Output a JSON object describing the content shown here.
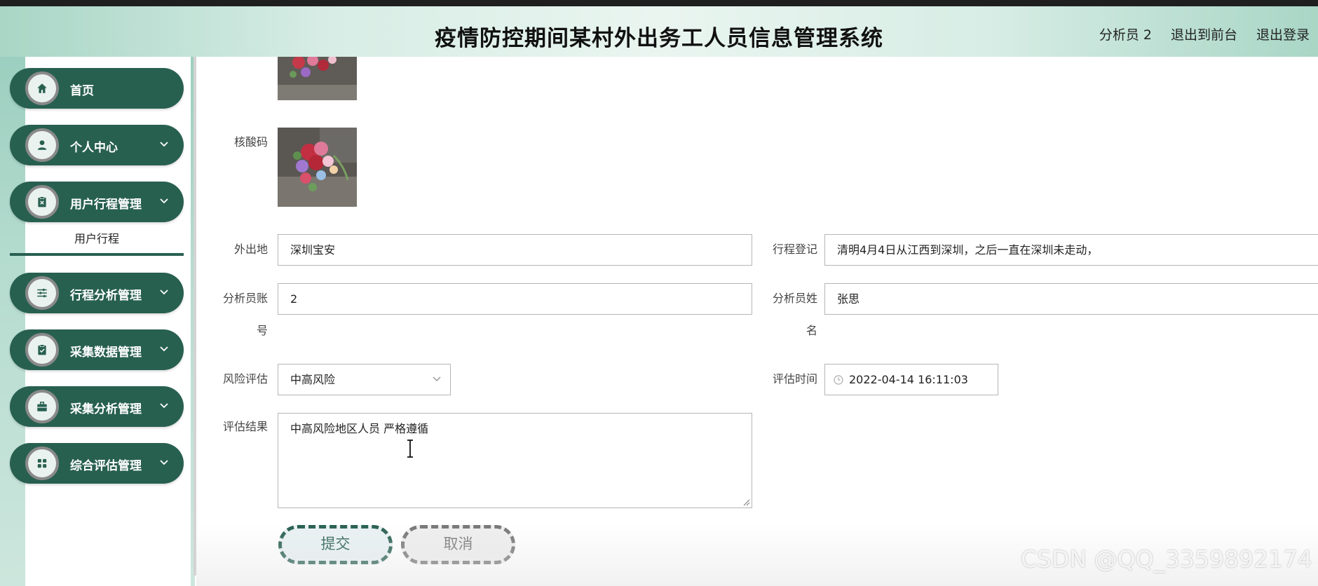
{
  "header": {
    "title": "疫情防控期间某村外出务工人员信息管理系统",
    "user_link": "分析员 2",
    "front_link": "退出到前台",
    "logout_link": "退出登录"
  },
  "sidebar": {
    "items": [
      {
        "label": "首页",
        "icon": "home-icon"
      },
      {
        "label": "个人中心",
        "icon": "user-icon"
      },
      {
        "label": "用户行程管理",
        "icon": "clipboard-x-icon"
      },
      {
        "label": "行程分析管理",
        "icon": "sliders-icon"
      },
      {
        "label": "采集数据管理",
        "icon": "clipboard-check-icon"
      },
      {
        "label": "采集分析管理",
        "icon": "briefcase-icon"
      },
      {
        "label": "综合评估管理",
        "icon": "grid-icon"
      }
    ],
    "submenu": {
      "label": "用户行程"
    }
  },
  "form": {
    "nucleic_label": "核酸码",
    "destination_label": "外出地",
    "destination_value": "深圳宝安",
    "trip_label": "行程登记",
    "trip_value": "清明4月4日从江西到深圳，之后一直在深圳未走动，",
    "analyst_account_label_1": "分析员账",
    "analyst_account_label_2": "号",
    "analyst_account_value": "2",
    "analyst_name_label_1": "分析员姓",
    "analyst_name_label_2": "名",
    "analyst_name_value": "张思",
    "risk_label": "风险评估",
    "risk_value": "中高风险",
    "eval_time_label": "评估时间",
    "eval_time_value": "2022-04-14 16:11:03",
    "result_label": "评估结果",
    "result_value": "中高风险地区人员 严格遵循"
  },
  "buttons": {
    "submit": "提交",
    "cancel": "取消"
  },
  "watermark": "CSDN @QQ_3359892174",
  "colors": {
    "primary": "#286050",
    "header_gradient": "#a9d6c6",
    "sidebar_bg": "#9ccfbf"
  }
}
